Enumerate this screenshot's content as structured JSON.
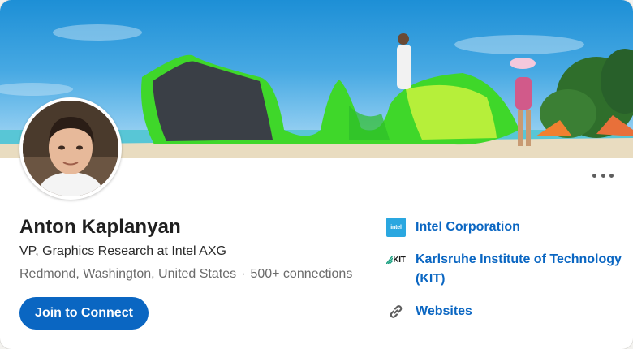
{
  "profile": {
    "name": "Anton Kaplanyan",
    "headline": "VP, Graphics Research at Intel AXG",
    "location": "Redmond, Washington, United States",
    "separator": "·",
    "connections": "500+ connections",
    "join_label": "Join to Connect",
    "more_icon": "more-horizontal-icon"
  },
  "links": [
    {
      "label": "Intel Corporation",
      "icon": "intel-logo",
      "logo_text": "intel"
    },
    {
      "label": "Karlsruhe Institute of Technology (KIT)",
      "icon": "kit-logo",
      "logo_text": "KIT"
    },
    {
      "label": "Websites",
      "icon": "link-icon"
    }
  ],
  "colors": {
    "accent": "#0a66c2",
    "kite_green": "#39d51f",
    "sky": "#2f9fe0"
  }
}
